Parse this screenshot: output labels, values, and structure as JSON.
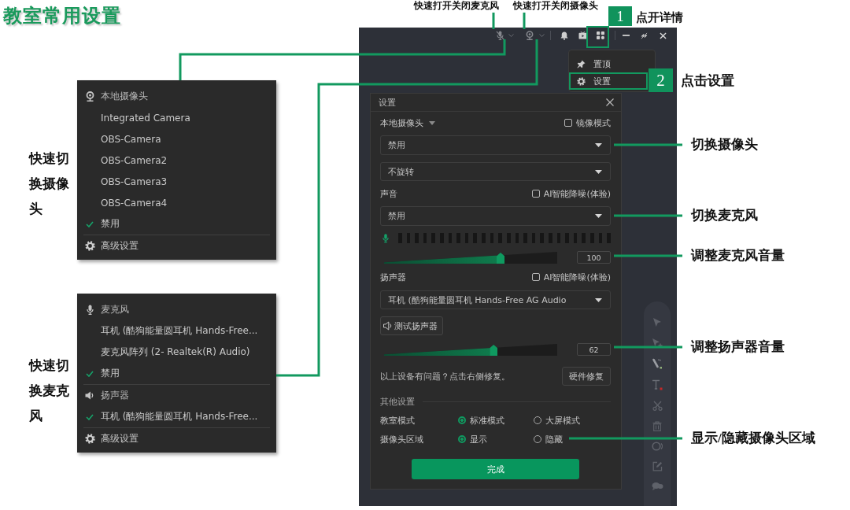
{
  "title": "教室常用设置",
  "top_callouts": [
    "快速打开关闭麦克风",
    "快速打开关闭摄像头"
  ],
  "step_callouts": [
    {
      "number": "1",
      "text": "点开详情"
    },
    {
      "number": "2",
      "text": "点击设置"
    }
  ],
  "side_callouts": [
    "快速切换摄像头",
    "快速切换麦克风"
  ],
  "right_callouts": [
    "切换摄像头",
    "切换麦克风",
    "调整麦克风音量",
    "调整扬声器音量",
    "显示/隐藏摄像头区域"
  ],
  "camera_menu": {
    "header": "本地摄像头",
    "items": [
      {
        "label": "Integrated Camera",
        "checked": false
      },
      {
        "label": "OBS-Camera",
        "checked": false
      },
      {
        "label": "OBS-Camera2",
        "checked": false
      },
      {
        "label": "OBS-Camera3",
        "checked": false
      },
      {
        "label": "OBS-Camera4",
        "checked": false
      },
      {
        "label": "禁用",
        "checked": true
      }
    ],
    "footer": "高级设置"
  },
  "audio_menu": {
    "sections": [
      {
        "kind": "microphone",
        "header": "麦克风",
        "items": [
          {
            "label": "耳机 (酷狗能量圆耳机 Hands-Free...",
            "checked": false
          },
          {
            "label": "麦克风阵列 (2- Realtek(R) Audio)",
            "checked": false
          },
          {
            "label": "禁用",
            "checked": true
          }
        ]
      },
      {
        "kind": "speaker",
        "header": "扬声器",
        "items": [
          {
            "label": "耳机 (酷狗能量圆耳机 Hands-Free...",
            "checked": true
          }
        ]
      }
    ],
    "footer": "高级设置"
  },
  "window": {
    "more_menu": {
      "items": [
        {
          "kind": "pin",
          "label": "置顶",
          "highlighted": false
        },
        {
          "kind": "settings",
          "label": "设置",
          "highlighted": true
        }
      ]
    },
    "settings_dialog": {
      "title": "设置",
      "camera": {
        "label": "本地摄像头",
        "mirror": {
          "label": "镜像模式",
          "checked": false
        },
        "device": "禁用",
        "rotation": "不旋转"
      },
      "sound": {
        "label": "声音",
        "denoise": {
          "label": "AI智能降噪(体验)",
          "checked": false
        },
        "device": "禁用",
        "volume": {
          "level": 0.65,
          "value": "100"
        }
      },
      "speaker": {
        "label": "扬声器",
        "denoise": {
          "label": "AI智能降噪(体验)",
          "checked": false
        },
        "device": "耳机 (酷狗能量圆耳机 Hands-Free AG Audio",
        "test_button": "测试扬声器",
        "volume": {
          "level": 0.61,
          "value": "62"
        }
      },
      "repair": {
        "text": "以上设备有问题？点击右侧修复。",
        "button": "硬件修复"
      },
      "other": {
        "heading": "其他设置",
        "rows": [
          {
            "label": "教室模式",
            "options": [
              {
                "label": "标准模式",
                "selected": true
              },
              {
                "label": "大屏模式",
                "selected": false
              }
            ]
          },
          {
            "label": "摄像头区域",
            "options": [
              {
                "label": "显示",
                "selected": true
              },
              {
                "label": "隐藏",
                "selected": false
              }
            ]
          }
        ]
      },
      "done_button": "完成"
    }
  }
}
